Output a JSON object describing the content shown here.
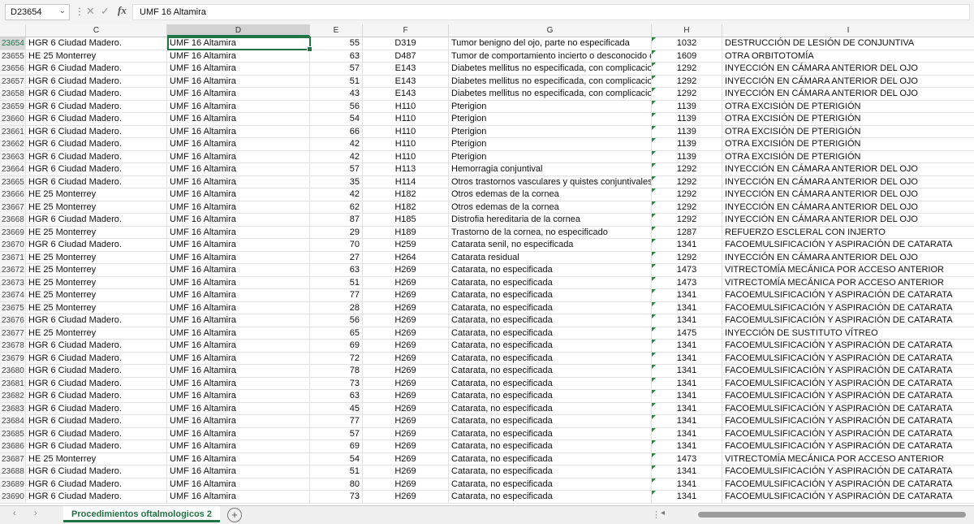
{
  "formula_bar": {
    "name_box": "D23654",
    "formula": "UMF 16 Altamira"
  },
  "columns": [
    "C",
    "D",
    "E",
    "F",
    "G",
    "H",
    "I"
  ],
  "selected_column": "D",
  "rows": [
    {
      "n": "23654",
      "c": "HGR 6 Ciudad Madero.",
      "d": "UMF 16 Altamira",
      "e": "55",
      "f": "D319",
      "g": "Tumor benigno del ojo, parte no especificada",
      "h": "1032",
      "i": "DESTRUCCIÓN DE LESIÓN DE CONJUNTIVA"
    },
    {
      "n": "23655",
      "c": "HE 25 Monterrey",
      "d": "UMF 16 Altamira",
      "e": "63",
      "f": "D487",
      "g": "Tumor de comportamiento incierto o desconocido d",
      "h": "1609",
      "i": "OTRA ORBITOTOMÍA"
    },
    {
      "n": "23656",
      "c": "HGR 6 Ciudad Madero.",
      "d": "UMF 16 Altamira",
      "e": "57",
      "f": "E143",
      "g": "Diabetes mellitus no especificada, con complicacio",
      "h": "1292",
      "i": "INYECCIÓN EN CÁMARA ANTERIOR DEL OJO"
    },
    {
      "n": "23657",
      "c": "HGR 6 Ciudad Madero.",
      "d": "UMF 16 Altamira",
      "e": "51",
      "f": "E143",
      "g": "Diabetes mellitus no especificada, con complicacio",
      "h": "1292",
      "i": "INYECCIÓN EN CÁMARA ANTERIOR DEL OJO"
    },
    {
      "n": "23658",
      "c": "HGR 6 Ciudad Madero.",
      "d": "UMF 16 Altamira",
      "e": "43",
      "f": "E143",
      "g": "Diabetes mellitus no especificada, con complicacio",
      "h": "1292",
      "i": "INYECCIÓN EN CÁMARA ANTERIOR DEL OJO"
    },
    {
      "n": "23659",
      "c": "HGR 6 Ciudad Madero.",
      "d": "UMF 16 Altamira",
      "e": "56",
      "f": "H110",
      "g": "Pterigion",
      "h": "1139",
      "i": "OTRA EXCISIÓN DE PTERIGIÓN"
    },
    {
      "n": "23660",
      "c": "HGR 6 Ciudad Madero.",
      "d": "UMF 16 Altamira",
      "e": "54",
      "f": "H110",
      "g": "Pterigion",
      "h": "1139",
      "i": "OTRA EXCISIÓN DE PTERIGIÓN"
    },
    {
      "n": "23661",
      "c": "HGR 6 Ciudad Madero.",
      "d": "UMF 16 Altamira",
      "e": "66",
      "f": "H110",
      "g": "Pterigion",
      "h": "1139",
      "i": "OTRA EXCISIÓN DE PTERIGIÓN"
    },
    {
      "n": "23662",
      "c": "HGR 6 Ciudad Madero.",
      "d": "UMF 16 Altamira",
      "e": "42",
      "f": "H110",
      "g": "Pterigion",
      "h": "1139",
      "i": "OTRA EXCISIÓN DE PTERIGIÓN"
    },
    {
      "n": "23663",
      "c": "HGR 6 Ciudad Madero.",
      "d": "UMF 16 Altamira",
      "e": "42",
      "f": "H110",
      "g": "Pterigion",
      "h": "1139",
      "i": "OTRA EXCISIÓN DE PTERIGIÓN"
    },
    {
      "n": "23664",
      "c": "HGR 6 Ciudad Madero.",
      "d": "UMF 16 Altamira",
      "e": "57",
      "f": "H113",
      "g": "Hemorragia conjuntival",
      "h": "1292",
      "i": "INYECCIÓN EN CÁMARA ANTERIOR DEL OJO"
    },
    {
      "n": "23665",
      "c": "HGR 6 Ciudad Madero.",
      "d": "UMF 16 Altamira",
      "e": "35",
      "f": "H114",
      "g": "Otros trastornos vasculares y quistes conjuntivales",
      "h": "1292",
      "i": "INYECCIÓN EN CÁMARA ANTERIOR DEL OJO"
    },
    {
      "n": "23666",
      "c": "HE 25 Monterrey",
      "d": "UMF 16 Altamira",
      "e": "42",
      "f": "H182",
      "g": "Otros edemas de la cornea",
      "h": "1292",
      "i": "INYECCIÓN EN CÁMARA ANTERIOR DEL OJO"
    },
    {
      "n": "23667",
      "c": "HE 25 Monterrey",
      "d": "UMF 16 Altamira",
      "e": "62",
      "f": "H182",
      "g": "Otros edemas de la cornea",
      "h": "1292",
      "i": "INYECCIÓN EN CÁMARA ANTERIOR DEL OJO"
    },
    {
      "n": "23668",
      "c": "HGR 6 Ciudad Madero.",
      "d": "UMF 16 Altamira",
      "e": "87",
      "f": "H185",
      "g": "Distrofia hereditaria de la cornea",
      "h": "1292",
      "i": "INYECCIÓN EN CÁMARA ANTERIOR DEL OJO"
    },
    {
      "n": "23669",
      "c": "HE 25 Monterrey",
      "d": "UMF 16 Altamira",
      "e": "29",
      "f": "H189",
      "g": "Trastorno de la cornea, no especificado",
      "h": "1287",
      "i": "REFUERZO ESCLERAL CON INJERTO"
    },
    {
      "n": "23670",
      "c": "HGR 6 Ciudad Madero.",
      "d": "UMF 16 Altamira",
      "e": "70",
      "f": "H259",
      "g": "Catarata senil, no especificada",
      "h": "1341",
      "i": "FACOEMULSIFICACIÓN Y ASPIRACIÓN DE CATARATA"
    },
    {
      "n": "23671",
      "c": "HE 25 Monterrey",
      "d": "UMF 16 Altamira",
      "e": "27",
      "f": "H264",
      "g": "Catarata residual",
      "h": "1292",
      "i": "INYECCIÓN EN CÁMARA ANTERIOR DEL OJO"
    },
    {
      "n": "23672",
      "c": "HE 25 Monterrey",
      "d": "UMF 16 Altamira",
      "e": "63",
      "f": "H269",
      "g": "Catarata, no especificada",
      "h": "1473",
      "i": "VITRECTOMÍA MECÁNICA POR ACCESO ANTERIOR"
    },
    {
      "n": "23673",
      "c": "HE 25 Monterrey",
      "d": "UMF 16 Altamira",
      "e": "51",
      "f": "H269",
      "g": "Catarata, no especificada",
      "h": "1473",
      "i": "VITRECTOMÍA MECÁNICA POR ACCESO ANTERIOR"
    },
    {
      "n": "23674",
      "c": "HE 25 Monterrey",
      "d": "UMF 16 Altamira",
      "e": "77",
      "f": "H269",
      "g": "Catarata, no especificada",
      "h": "1341",
      "i": "FACOEMULSIFICACIÓN Y ASPIRACIÓN DE CATARATA"
    },
    {
      "n": "23675",
      "c": "HE 25 Monterrey",
      "d": "UMF 16 Altamira",
      "e": "28",
      "f": "H269",
      "g": "Catarata, no especificada",
      "h": "1341",
      "i": "FACOEMULSIFICACIÓN Y ASPIRACIÓN DE CATARATA"
    },
    {
      "n": "23676",
      "c": "HGR 6 Ciudad Madero.",
      "d": "UMF 16 Altamira",
      "e": "56",
      "f": "H269",
      "g": "Catarata, no especificada",
      "h": "1341",
      "i": "FACOEMULSIFICACIÓN Y ASPIRACIÓN DE CATARATA"
    },
    {
      "n": "23677",
      "c": "HE 25 Monterrey",
      "d": "UMF 16 Altamira",
      "e": "65",
      "f": "H269",
      "g": "Catarata, no especificada",
      "h": "1475",
      "i": "INYECCIÓN DE SUSTITUTO VÍTREO"
    },
    {
      "n": "23678",
      "c": "HGR 6 Ciudad Madero.",
      "d": "UMF 16 Altamira",
      "e": "69",
      "f": "H269",
      "g": "Catarata, no especificada",
      "h": "1341",
      "i": "FACOEMULSIFICACIÓN Y ASPIRACIÓN DE CATARATA"
    },
    {
      "n": "23679",
      "c": "HGR 6 Ciudad Madero.",
      "d": "UMF 16 Altamira",
      "e": "72",
      "f": "H269",
      "g": "Catarata, no especificada",
      "h": "1341",
      "i": "FACOEMULSIFICACIÓN Y ASPIRACIÓN DE CATARATA"
    },
    {
      "n": "23680",
      "c": "HGR 6 Ciudad Madero.",
      "d": "UMF 16 Altamira",
      "e": "78",
      "f": "H269",
      "g": "Catarata, no especificada",
      "h": "1341",
      "i": "FACOEMULSIFICACIÓN Y ASPIRACIÓN DE CATARATA"
    },
    {
      "n": "23681",
      "c": "HGR 6 Ciudad Madero.",
      "d": "UMF 16 Altamira",
      "e": "73",
      "f": "H269",
      "g": "Catarata, no especificada",
      "h": "1341",
      "i": "FACOEMULSIFICACIÓN Y ASPIRACIÓN DE CATARATA"
    },
    {
      "n": "23682",
      "c": "HGR 6 Ciudad Madero.",
      "d": "UMF 16 Altamira",
      "e": "63",
      "f": "H269",
      "g": "Catarata, no especificada",
      "h": "1341",
      "i": "FACOEMULSIFICACIÓN Y ASPIRACIÓN DE CATARATA"
    },
    {
      "n": "23683",
      "c": "HGR 6 Ciudad Madero.",
      "d": "UMF 16 Altamira",
      "e": "45",
      "f": "H269",
      "g": "Catarata, no especificada",
      "h": "1341",
      "i": "FACOEMULSIFICACIÓN Y ASPIRACIÓN DE CATARATA"
    },
    {
      "n": "23684",
      "c": "HGR 6 Ciudad Madero.",
      "d": "UMF 16 Altamira",
      "e": "77",
      "f": "H269",
      "g": "Catarata, no especificada",
      "h": "1341",
      "i": "FACOEMULSIFICACIÓN Y ASPIRACIÓN DE CATARATA"
    },
    {
      "n": "23685",
      "c": "HGR 6 Ciudad Madero.",
      "d": "UMF 16 Altamira",
      "e": "57",
      "f": "H269",
      "g": "Catarata, no especificada",
      "h": "1341",
      "i": "FACOEMULSIFICACIÓN Y ASPIRACIÓN DE CATARATA"
    },
    {
      "n": "23686",
      "c": "HGR 6 Ciudad Madero.",
      "d": "UMF 16 Altamira",
      "e": "69",
      "f": "H269",
      "g": "Catarata, no especificada",
      "h": "1341",
      "i": "FACOEMULSIFICACIÓN Y ASPIRACIÓN DE CATARATA"
    },
    {
      "n": "23687",
      "c": "HE 25 Monterrey",
      "d": "UMF 16 Altamira",
      "e": "54",
      "f": "H269",
      "g": "Catarata, no especificada",
      "h": "1473",
      "i": "VITRECTOMÍA MECÁNICA POR ACCESO ANTERIOR"
    },
    {
      "n": "23688",
      "c": "HGR 6 Ciudad Madero.",
      "d": "UMF 16 Altamira",
      "e": "51",
      "f": "H269",
      "g": "Catarata, no especificada",
      "h": "1341",
      "i": "FACOEMULSIFICACIÓN Y ASPIRACIÓN DE CATARATA"
    },
    {
      "n": "23689",
      "c": "HGR 6 Ciudad Madero.",
      "d": "UMF 16 Altamira",
      "e": "80",
      "f": "H269",
      "g": "Catarata, no especificada",
      "h": "1341",
      "i": "FACOEMULSIFICACIÓN Y ASPIRACIÓN DE CATARATA"
    },
    {
      "n": "23690",
      "c": "HGR 6 Ciudad Madero.",
      "d": "UMF 16 Altamira",
      "e": "73",
      "f": "H269",
      "g": "Catarata, no especificada",
      "h": "1341",
      "i": "FACOEMULSIFICACIÓN Y ASPIRACIÓN DE CATARATA"
    }
  ],
  "sheet_tabs": [
    "Procedimientos oftalmologicos 2"
  ],
  "icons": {
    "name_box_dropdown": "chevron-down-icon",
    "more": "vertical-dots-icon",
    "cancel": "x-icon",
    "confirm": "check-icon",
    "function": "fx-icon",
    "add_sheet": "plus-circle-icon"
  },
  "colors": {
    "accent": "#217346",
    "comment_marker": "#1e8a3c"
  }
}
